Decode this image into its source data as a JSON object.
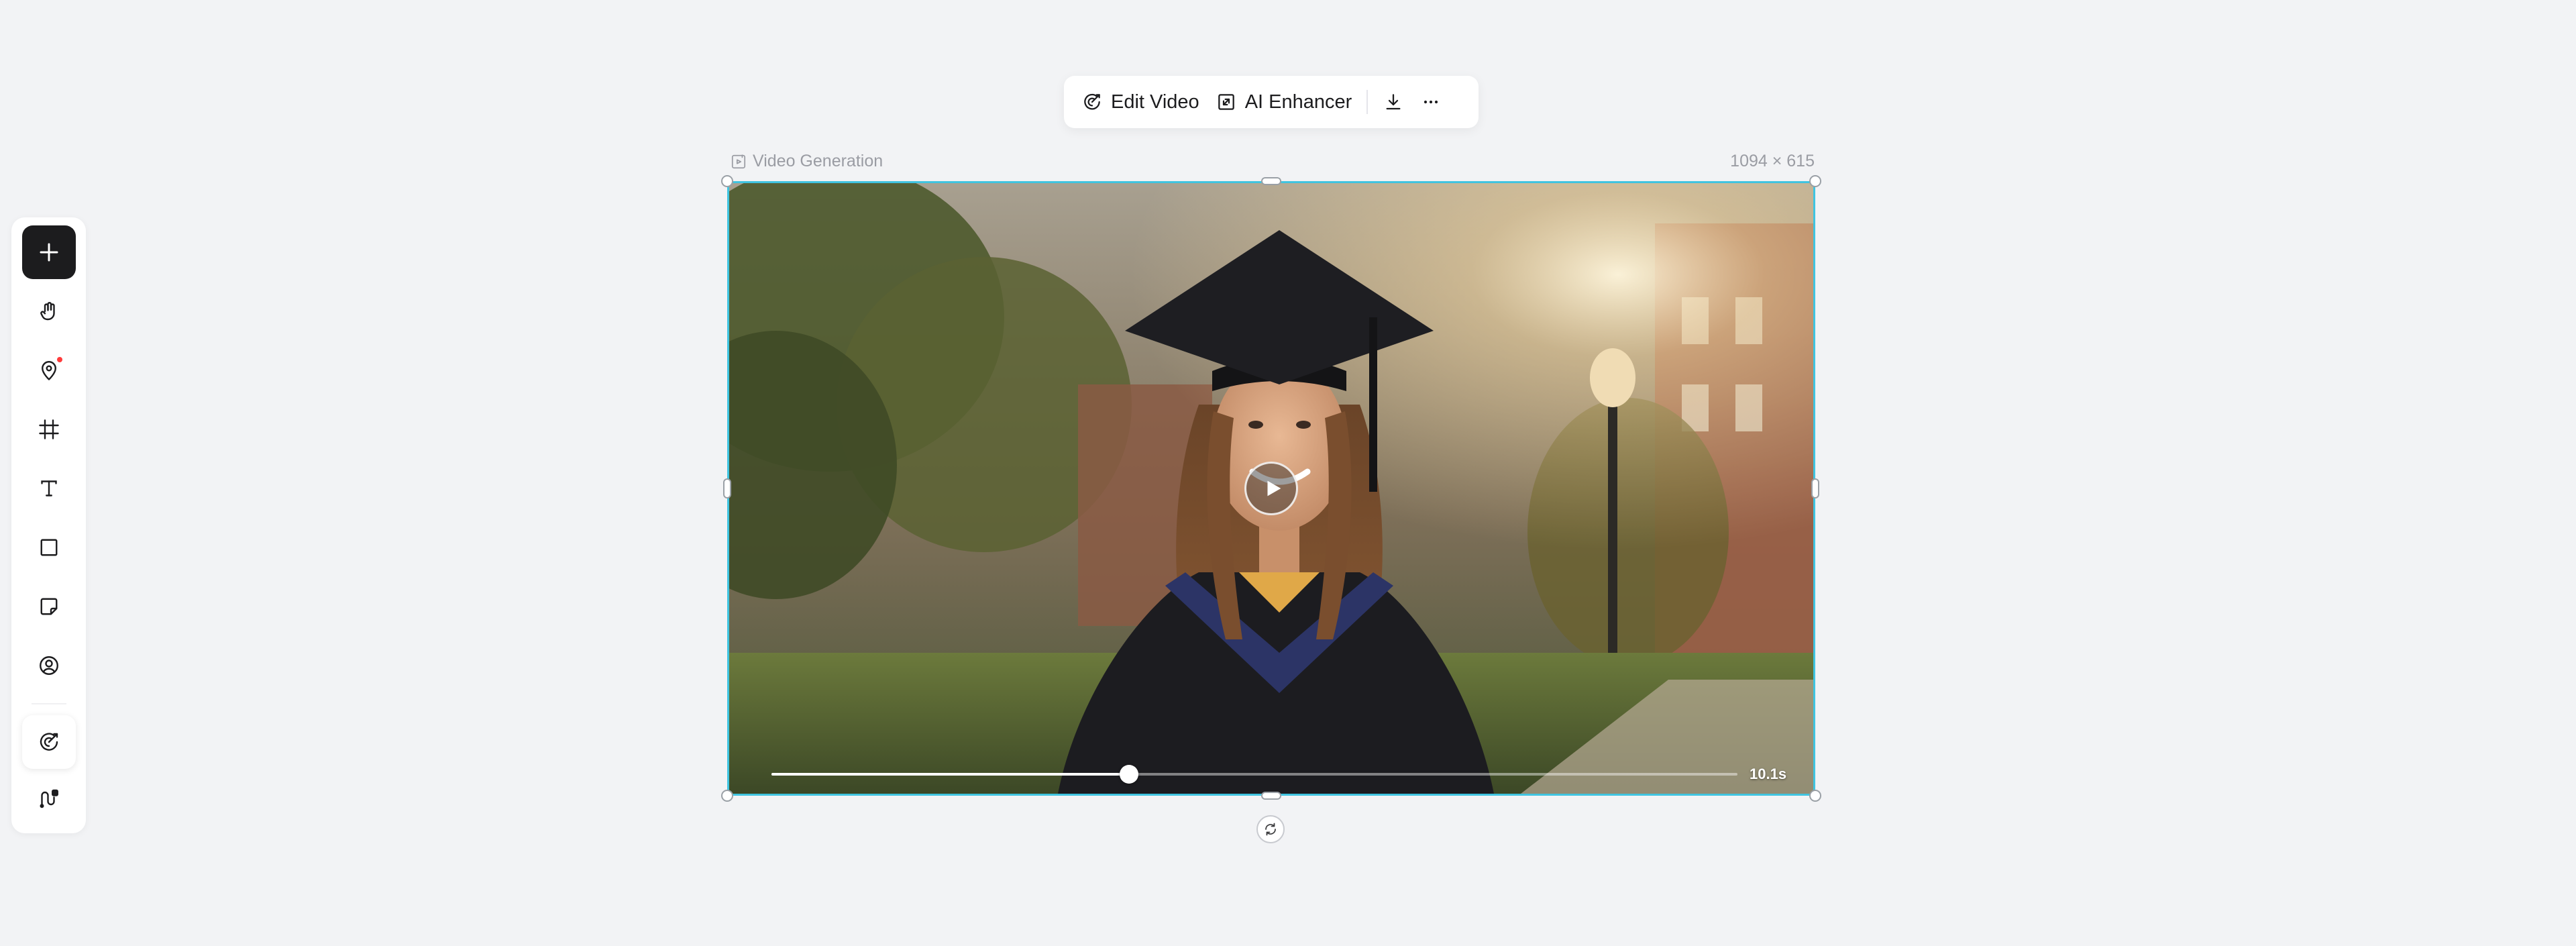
{
  "left_toolbar": {
    "items": [
      {
        "name": "add",
        "icon": "plus-icon"
      },
      {
        "name": "hand",
        "icon": "hand-icon"
      },
      {
        "name": "location",
        "icon": "map-pin-icon",
        "has_notification_dot": true
      },
      {
        "name": "frame",
        "icon": "frame-icon"
      },
      {
        "name": "text",
        "icon": "text-icon"
      },
      {
        "name": "shape",
        "icon": "square-icon"
      },
      {
        "name": "sticky-note",
        "icon": "sticky-note-icon"
      },
      {
        "name": "avatar",
        "icon": "user-circle-icon"
      },
      {
        "name": "edit-video",
        "icon": "edit-video-icon"
      },
      {
        "name": "workflow",
        "icon": "workflow-icon"
      }
    ]
  },
  "top_toolbar": {
    "edit_video_label": "Edit Video",
    "ai_enhancer_label": "AI Enhancer",
    "download_icon": "download-icon",
    "more_icon": "more-horizontal-icon"
  },
  "frame": {
    "label": "Video Generation",
    "size_label": "1094 × 615",
    "selection_color": "#40c4e0"
  },
  "video": {
    "duration_label": "10.1s",
    "progress": 0.37
  },
  "colors": {
    "background": "#f2f3f5",
    "primary_button": "#1c1c1e",
    "notification_dot": "#ff3b3b"
  }
}
